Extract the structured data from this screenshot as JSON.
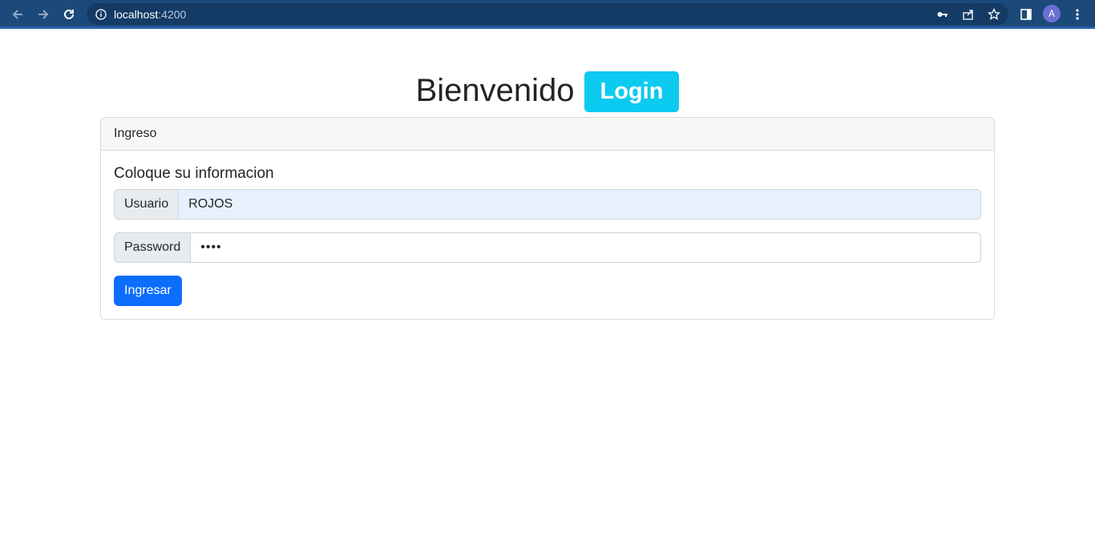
{
  "browser": {
    "url_host": "localhost",
    "url_port": ":4200",
    "profile_initial": "A",
    "icons": {
      "back": "arrow-left-icon",
      "forward": "arrow-right-icon",
      "reload": "reload-icon",
      "site_info": "info-circle-icon",
      "password": "key-icon",
      "share": "share-icon",
      "bookmark": "star-icon",
      "side_panel": "side-panel-icon",
      "menu": "kebab-menu-icon"
    }
  },
  "page": {
    "title": "Bienvenido",
    "badge": "Login"
  },
  "card": {
    "header": "Ingreso",
    "subtitle": "Coloque su informacion",
    "user_label": "Usuario",
    "user_value": "ROJOS",
    "password_label": "Password",
    "password_value": "••••",
    "submit_label": "Ingresar"
  },
  "colors": {
    "chrome": "#1b4a7a",
    "badge": "#0dcaf0",
    "primary": "#0d6efd",
    "autofill": "#e8f0fe"
  }
}
